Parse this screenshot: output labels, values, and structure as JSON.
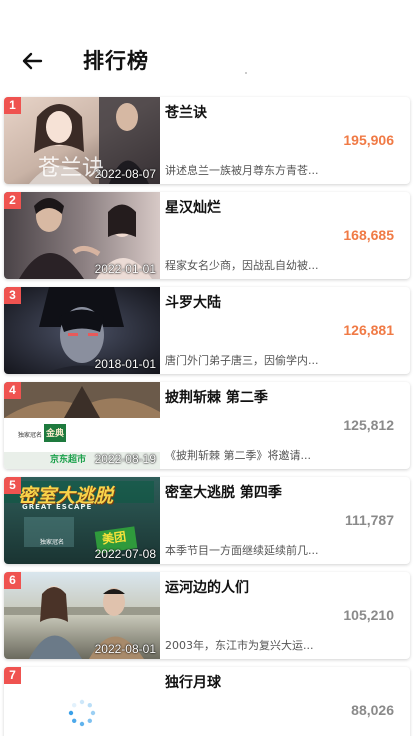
{
  "header": {
    "title": "排行榜",
    "back_icon": "arrow-left-icon"
  },
  "colors": {
    "rank_badge": "#ef5350",
    "hot_count": "#f07a45",
    "normal_count": "#8a8a8a"
  },
  "items": [
    {
      "rank": "1",
      "title": "苍兰诀",
      "count": "195,906",
      "desc": "讲述息兰一族被月尊东方青苍...",
      "date": "2022-08-07",
      "hot": true
    },
    {
      "rank": "2",
      "title": "星汉灿烂",
      "count": "168,685",
      "desc": "程家女名少商，因战乱自幼被...",
      "date": "2022-01-01",
      "hot": true
    },
    {
      "rank": "3",
      "title": "斗罗大陆",
      "count": "126,881",
      "desc": "唐门外门弟子唐三，因偷学内...",
      "date": "2018-01-01",
      "hot": true
    },
    {
      "rank": "4",
      "title": "披荆斩棘 第二季",
      "count": "125,812",
      "desc": "《披荆斩棘 第二季》将邀请...",
      "date": "2022-08-19",
      "hot": false,
      "poster_text": [
        "独家冠名",
        "金典",
        "京东超市"
      ]
    },
    {
      "rank": "5",
      "title": "密室大逃脱 第四季",
      "count": "111,787",
      "desc": "本季节目一方面继续延续前几...",
      "date": "2022-07-08",
      "hot": false,
      "poster_text": [
        "密室大逃脱",
        "GREAT ESCAPE",
        "独家冠名",
        "美团"
      ]
    },
    {
      "rank": "6",
      "title": "运河边的人们",
      "count": "105,210",
      "desc": "2003年，东江市为复兴大运...",
      "date": "2022-08-01",
      "hot": false
    },
    {
      "rank": "7",
      "title": "独行月球",
      "count": "88,026",
      "desc": "",
      "date": "",
      "hot": false,
      "loading": true
    }
  ]
}
